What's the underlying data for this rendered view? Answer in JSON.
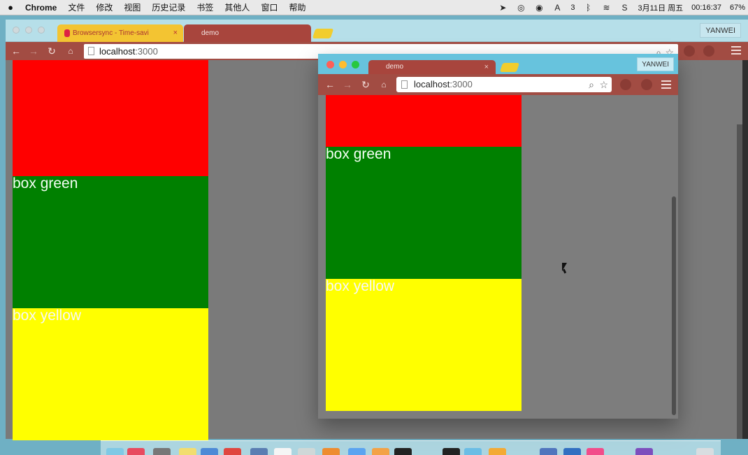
{
  "menubar": {
    "apple_icon": "apple-icon",
    "app_name": "Chrome",
    "items": [
      "文件",
      "修改",
      "视图",
      "历史记录",
      "书签",
      "其他人",
      "窗口",
      "帮助"
    ],
    "status_number": "3",
    "date": "3月11日 周五",
    "time": "00:16:37",
    "battery": "67%"
  },
  "big_browser": {
    "tabs": [
      {
        "label": "Browsersync - Time-savi",
        "close": "×"
      },
      {
        "label": "demo"
      }
    ],
    "profile": "YANWEI",
    "url_host": "localhost",
    "url_port": ":3000",
    "boxes": {
      "green_label": "box green",
      "yellow_label": "box yellow"
    }
  },
  "small_browser": {
    "tab_label": "demo",
    "tab_close": "×",
    "profile": "YANWEI",
    "url_host": "localhost",
    "url_port": ":3000",
    "boxes": {
      "green_label": "box green",
      "yellow_label": "box yellow"
    }
  },
  "colors": {
    "red": "#ff0000",
    "green": "#008000",
    "yellow": "#ffff00",
    "toolbar": "#a24c43",
    "titlebar": "#67c3dd"
  },
  "dock": {
    "icons": [
      "finder-icon",
      "calendar-icon",
      "app-icon",
      "notes-icon",
      "safari-icon",
      "chrome-icon",
      "network-icon",
      "document-icon",
      "preview-icon",
      "photos-icon",
      "app-store-icon",
      "firefox-icon",
      "terminal-icon",
      "terminal-icon",
      "folder-icon",
      "folder-icon",
      "sketch-icon",
      "vscode-icon",
      "music-icon",
      "github-icon",
      "trash-icon"
    ]
  }
}
